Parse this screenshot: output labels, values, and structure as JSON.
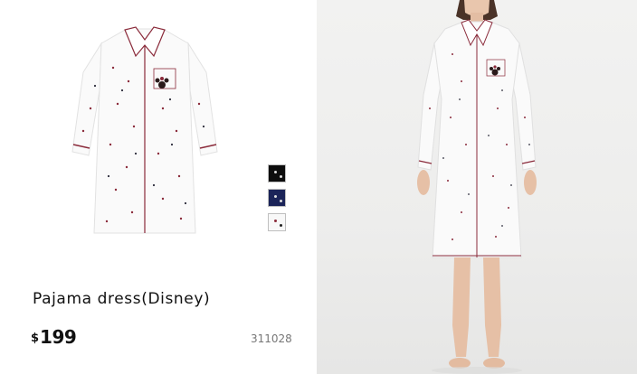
{
  "product": {
    "name": "Pajama dress(Disney)",
    "currency_symbol": "$",
    "price": "199",
    "code": "311028"
  },
  "swatches": [
    {
      "color_name": "black",
      "hex": "#0d0d0d",
      "selected": false
    },
    {
      "color_name": "navy",
      "hex": "#1b2459",
      "selected": false
    },
    {
      "color_name": "white",
      "hex": "#f8f8f8",
      "selected": true
    }
  ],
  "colors": {
    "dress_fabric": "#fafafa",
    "piping": "#8a2a3a",
    "price_text": "#111111",
    "code_text": "#777777",
    "photo_background": "#efefee"
  }
}
